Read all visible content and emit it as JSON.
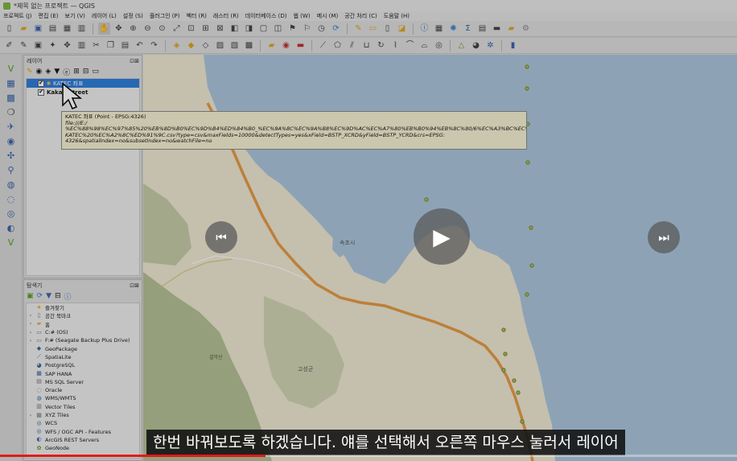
{
  "window": {
    "title": "*제목 없는 프로젝트 — QGIS"
  },
  "menu": [
    "프로젝트 (J)",
    "편집 (E)",
    "보기 (V)",
    "레이어 (L)",
    "설정 (S)",
    "플러그인 (P)",
    "벡터 (R)",
    "래스터 (R)",
    "데이터베이스 (D)",
    "웹 (W)",
    "메시 (M)",
    "공간 처리 (C)",
    "도움말 (H)"
  ],
  "layers_panel": {
    "title": "레이어",
    "layers": [
      {
        "name": "KATEC 좌표",
        "checked": true,
        "selected": true
      },
      {
        "name": "Kakao Street",
        "checked": true,
        "selected": false
      }
    ]
  },
  "tooltip": {
    "title": "KATEC 좌표 (Point - EPSG:4326)",
    "lines": [
      "file:///E:/",
      "%EC%88%98%EC%97%85%20%EB%8D%B0%EC%9D%B4%ED%84%B0_%EC%9A%8C%EC%9A%B8%EC%9D%AC%EC%A7%80%EB%B0%94%EB%8C%80/6%EC%A3%BC%EC%B0%A8/",
      "KATEC%20%EC%A2%8C%ED%91%9C.csv?type=csv&maxFields=10000&detectTypes=yes&xField=BSTP_XCRD&yField=BSTP_YCRD&crs=EPSG:",
      "4326&spatialIndex=no&subsetIndex=no&watchFile=no"
    ]
  },
  "browser_panel": {
    "title": "탐색기",
    "items": [
      {
        "label": "즐겨찾기",
        "icon": "star-icon",
        "expandable": false
      },
      {
        "label": "공간 북마크",
        "icon": "bookmark-icon",
        "expandable": true
      },
      {
        "label": "홈",
        "icon": "folder-icon",
        "expandable": true
      },
      {
        "label": "C:# (OS)",
        "icon": "drive-icon",
        "expandable": true
      },
      {
        "label": "F:# (Seagate Backup Plus Drive)",
        "icon": "drive-icon",
        "expandable": true
      },
      {
        "label": "GeoPackage",
        "icon": "geopackage-icon",
        "expandable": false
      },
      {
        "label": "SpatiaLite",
        "icon": "spatialite-icon",
        "expandable": false
      },
      {
        "label": "PostgreSQL",
        "icon": "postgresql-icon",
        "expandable": false
      },
      {
        "label": "SAP HANA",
        "icon": "sap-hana-icon",
        "expandable": false
      },
      {
        "label": "MS SQL Server",
        "icon": "mssql-icon",
        "expandable": false
      },
      {
        "label": "Oracle",
        "icon": "oracle-icon",
        "expandable": false
      },
      {
        "label": "WMS/WMTS",
        "icon": "wms-icon",
        "expandable": false
      },
      {
        "label": "Vector Tiles",
        "icon": "vector-tiles-icon",
        "expandable": false
      },
      {
        "label": "XYZ Tiles",
        "icon": "xyz-tiles-icon",
        "expandable": true
      },
      {
        "label": "WCS",
        "icon": "wcs-icon",
        "expandable": false
      },
      {
        "label": "WFS / OGC API - Features",
        "icon": "wfs-icon",
        "expandable": false
      },
      {
        "label": "ArcGIS REST Servers",
        "icon": "arcgis-icon",
        "expandable": false
      },
      {
        "label": "GeoNode",
        "icon": "geonode-icon",
        "expandable": false
      }
    ]
  },
  "map": {
    "labels": [
      {
        "text": "속초시"
      },
      {
        "text": "고성군"
      },
      {
        "text": "설악산"
      }
    ],
    "colors": {
      "sea": "#aac4da",
      "land": "#ede6d2",
      "road": "#e39a45",
      "forest": "#a9b98c"
    }
  },
  "video": {
    "subtitle": "한번 바꿔보도록 하겠습니다. 얘를 선택해서 오른쪽 마우스 눌러서 레이어",
    "progress": 0.36,
    "accent": "#e21a1a"
  }
}
